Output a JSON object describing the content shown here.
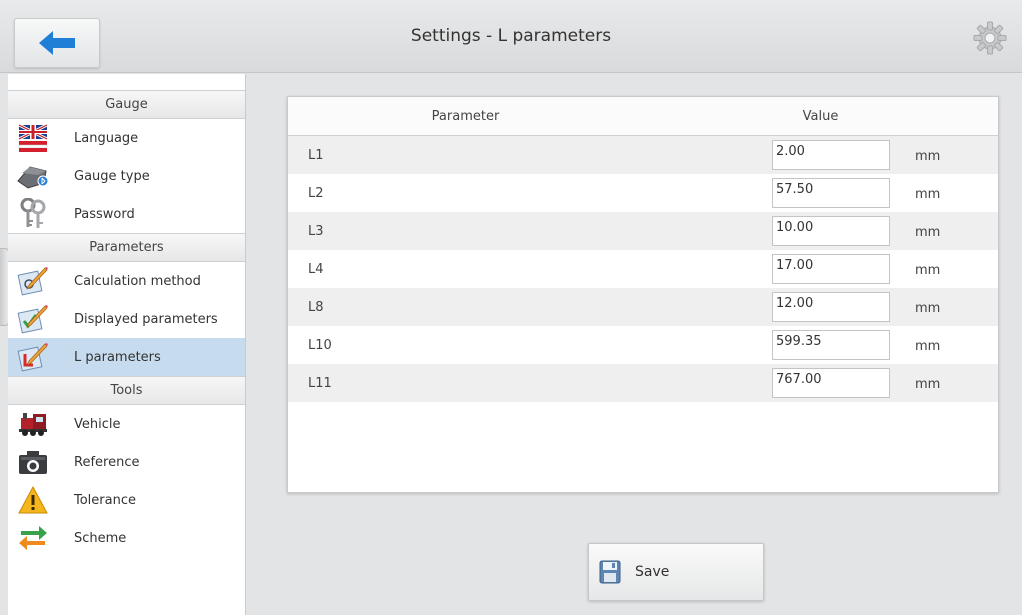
{
  "header": {
    "title": "Settings - L parameters",
    "back_icon": "arrow-left-icon",
    "settings_icon": "gear-icon"
  },
  "sidebar": {
    "sections": [
      {
        "title": "Gauge",
        "items": [
          {
            "label": "Language",
            "icon": "uk-flag-icon"
          },
          {
            "label": "Gauge type",
            "icon": "gauge-device-icon"
          },
          {
            "label": "Password",
            "icon": "keys-icon"
          }
        ]
      },
      {
        "title": "Parameters",
        "items": [
          {
            "label": "Calculation method",
            "icon": "calculation-edit-icon"
          },
          {
            "label": "Displayed parameters",
            "icon": "checklist-edit-icon"
          },
          {
            "label": "L parameters",
            "icon": "l-edit-icon",
            "selected": true
          }
        ]
      },
      {
        "title": "Tools",
        "items": [
          {
            "label": "Vehicle",
            "icon": "locomotive-icon"
          },
          {
            "label": "Reference",
            "icon": "camera-icon"
          },
          {
            "label": "Tolerance",
            "icon": "warning-icon"
          },
          {
            "label": "Scheme",
            "icon": "swap-arrows-icon"
          }
        ]
      }
    ]
  },
  "table": {
    "header_parameter": "Parameter",
    "header_value": "Value",
    "rows": [
      {
        "name": "L1",
        "value": "2.00",
        "unit": "mm"
      },
      {
        "name": "L2",
        "value": "57.50",
        "unit": "mm"
      },
      {
        "name": "L3",
        "value": "10.00",
        "unit": "mm"
      },
      {
        "name": "L4",
        "value": "17.00",
        "unit": "mm"
      },
      {
        "name": "L8",
        "value": "12.00",
        "unit": "mm"
      },
      {
        "name": "L10",
        "value": "599.35",
        "unit": "mm"
      },
      {
        "name": "L11",
        "value": "767.00",
        "unit": "mm"
      }
    ]
  },
  "save": {
    "label": "Save",
    "icon": "floppy-disk-icon"
  },
  "colors": {
    "accent_blue": "#1f7fd6",
    "selected_row": "#c7dbee",
    "background": "#e3e4e5"
  }
}
